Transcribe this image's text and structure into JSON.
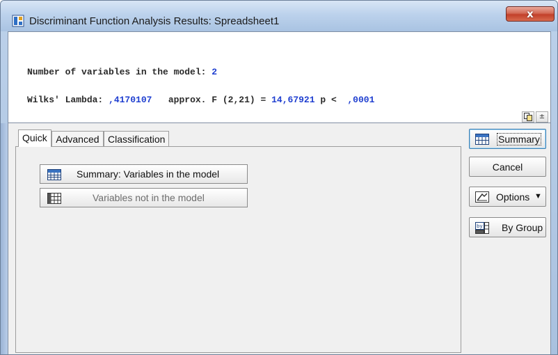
{
  "window": {
    "title": "Discriminant Function Analysis Results: Spreadsheet1",
    "close_label": "x"
  },
  "results": {
    "vars_label": "Number of variables in the model:",
    "vars_value": "2",
    "wilks_label": "Wilks' Lambda:",
    "wilks_value": ",4170107",
    "approx_label": "approx. F (2,21) =",
    "f_value": "14,67921",
    "p_label": "p <",
    "p_value": ",0001"
  },
  "results_buttons": {
    "copy_icon": "copy-icon",
    "expand_label": "±"
  },
  "tabs": [
    {
      "label": "Quick",
      "active": true
    },
    {
      "label": "Advanced",
      "active": false
    },
    {
      "label": "Classification",
      "active": false
    }
  ],
  "quick": {
    "summary_button": {
      "label": "Summary:  Variables in the model",
      "icon": "summary-table-icon"
    },
    "not_in_model_button": {
      "label": "Variables not in the model",
      "icon": "grid-table-icon",
      "disabled": true
    }
  },
  "side": {
    "summary_label": "Summary",
    "cancel_label": "Cancel",
    "options_label": "Options",
    "options_arrow": "▼",
    "bygroup_label": "By Group"
  },
  "colors": {
    "value_text": "#1f3fd0",
    "close_button": "#c2402a"
  }
}
